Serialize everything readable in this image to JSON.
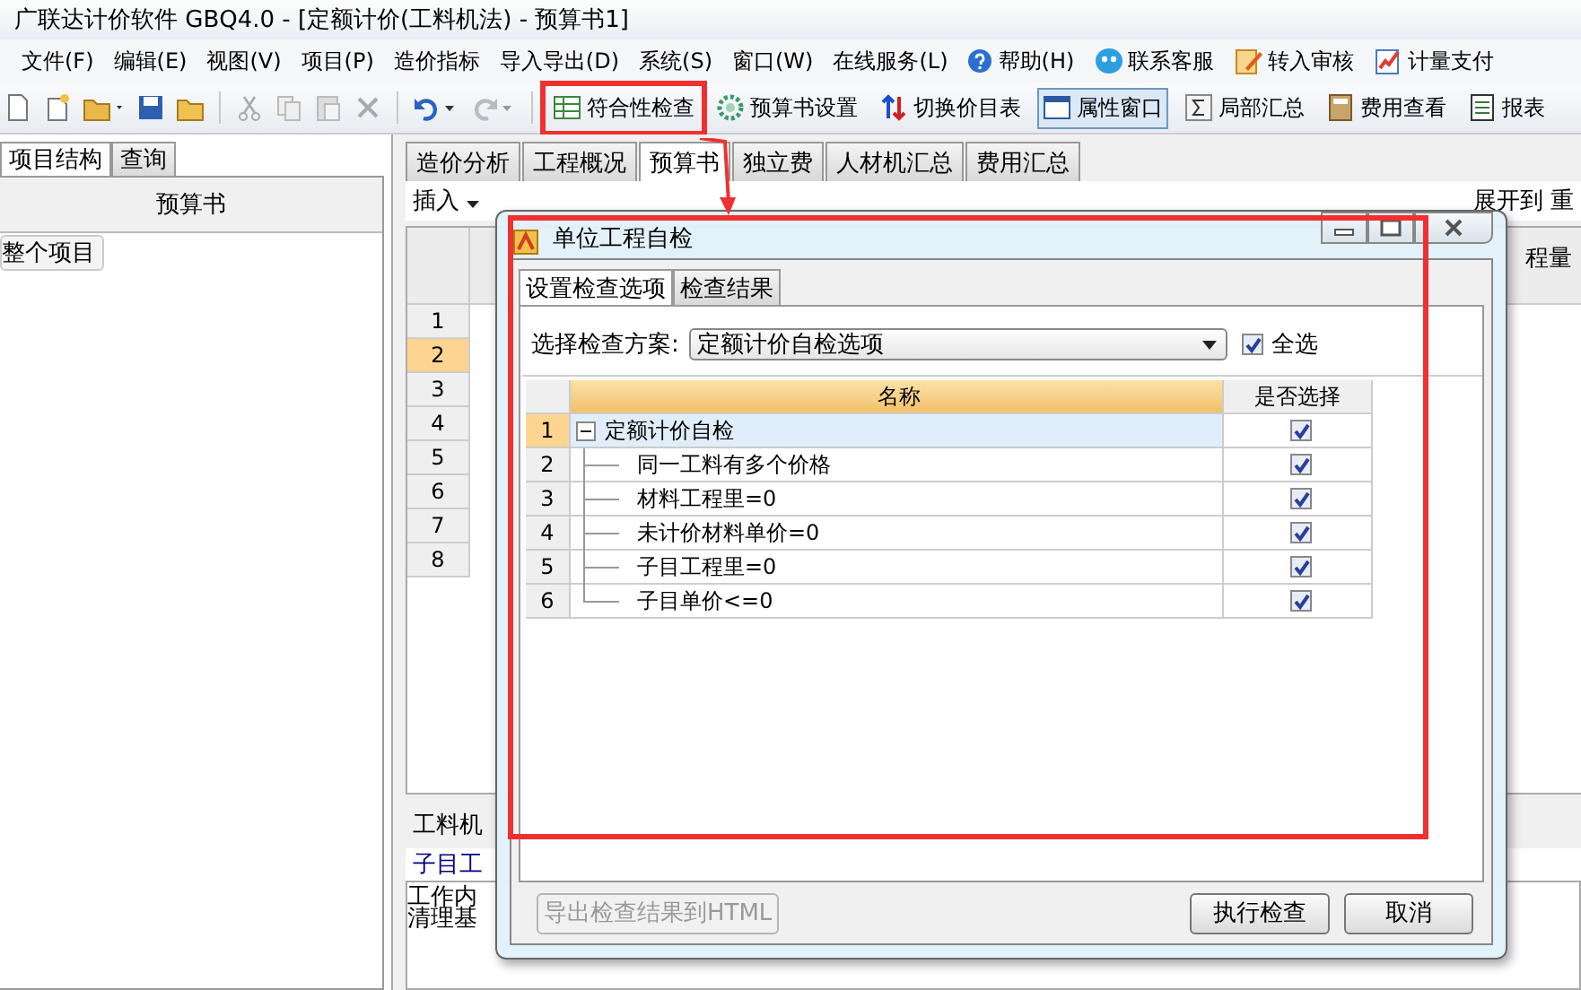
{
  "window": {
    "title": "广联达计价软件 GBQ4.0 - [定额计价(工料机法) - 预算书1]"
  },
  "menu": [
    {
      "label": "文件(F)",
      "kind": "plain"
    },
    {
      "label": "编辑(E)",
      "kind": "plain"
    },
    {
      "label": "视图(V)",
      "kind": "plain"
    },
    {
      "label": "项目(P)",
      "kind": "plain"
    },
    {
      "label": "造价指标",
      "kind": "plain"
    },
    {
      "label": "导入导出(D)",
      "kind": "plain"
    },
    {
      "label": "系统(S)",
      "kind": "plain"
    },
    {
      "label": "窗口(W)",
      "kind": "plain"
    },
    {
      "label": "在线服务(L)",
      "kind": "plain"
    },
    {
      "label": "帮助(H)",
      "kind": "help"
    },
    {
      "label": "联系客服",
      "kind": "service"
    },
    {
      "label": "转入审核",
      "kind": "audit"
    },
    {
      "label": "计量支付",
      "kind": "pay"
    }
  ],
  "toolbar": [
    {
      "label": "符合性检查",
      "kind": "check",
      "selected": false,
      "highlighted": true
    },
    {
      "label": "预算书设置",
      "kind": "gear",
      "selected": false
    },
    {
      "label": "切换价目表",
      "kind": "switch",
      "selected": false
    },
    {
      "label": "属性窗口",
      "kind": "window",
      "selected": true
    },
    {
      "label": "局部汇总",
      "kind": "sigma",
      "selected": false
    },
    {
      "label": "费用查看",
      "kind": "calc",
      "selected": false
    },
    {
      "label": "报表",
      "kind": "report",
      "selected": false
    }
  ],
  "left_panel": {
    "tabs": [
      {
        "label": "项目结构",
        "selected": true
      },
      {
        "label": "查询",
        "selected": false
      }
    ],
    "header": "预算书",
    "tree": [
      "整个项目"
    ]
  },
  "main_tabs": [
    {
      "label": "造价分析",
      "selected": false
    },
    {
      "label": "工程概况",
      "selected": false
    },
    {
      "label": "预算书",
      "selected": true
    },
    {
      "label": "独立费",
      "selected": false
    },
    {
      "label": "人材机汇总",
      "selected": false
    },
    {
      "label": "费用汇总",
      "selected": false
    }
  ],
  "sub_toolbar": {
    "insert": "插入",
    "expand": "展开到",
    "cut": "重"
  },
  "grid": {
    "column_header": "程量",
    "rows": [
      {
        "number": "1",
        "selected": false
      },
      {
        "number": "2",
        "selected": true
      },
      {
        "number": "3",
        "selected": false
      },
      {
        "number": "4",
        "selected": false
      },
      {
        "number": "5",
        "selected": false
      },
      {
        "number": "6",
        "selected": false
      },
      {
        "number": "7",
        "selected": false
      },
      {
        "number": "8",
        "selected": false
      }
    ]
  },
  "bottom": {
    "tab": "工料机",
    "label": "子目工",
    "text": [
      "工作内",
      "清理基"
    ]
  },
  "dialog": {
    "title": "单位工程自检",
    "tabs": [
      {
        "label": "设置检查选项",
        "selected": true
      },
      {
        "label": "检查结果",
        "selected": false
      }
    ],
    "scheme_label": "选择检查方案:",
    "scheme_value": "定额计价自检选项",
    "select_all": {
      "label": "全选",
      "checked": true
    },
    "columns": [
      "名称",
      "是否选择"
    ],
    "rows": [
      {
        "number": "1",
        "name": "定额计价自检",
        "checked": true,
        "selected": true,
        "expanded": true,
        "children": [
          {
            "number": "2",
            "name": "同一工料有多个价格",
            "checked": true,
            "selected": false
          },
          {
            "number": "3",
            "name": "材料工程里=0",
            "checked": true,
            "selected": false
          },
          {
            "number": "4",
            "name": "未计价材料单价=0",
            "checked": true,
            "selected": false
          },
          {
            "number": "5",
            "name": "子目工程里=0",
            "checked": true,
            "selected": false
          },
          {
            "number": "6",
            "name": "子目单价<=0",
            "checked": true,
            "selected": false
          }
        ]
      }
    ],
    "buttons": [
      {
        "label": "导出检查结果到HTML",
        "disabled": true
      },
      {
        "label": "执行检查",
        "disabled": false
      },
      {
        "label": "取消",
        "disabled": false
      }
    ]
  }
}
